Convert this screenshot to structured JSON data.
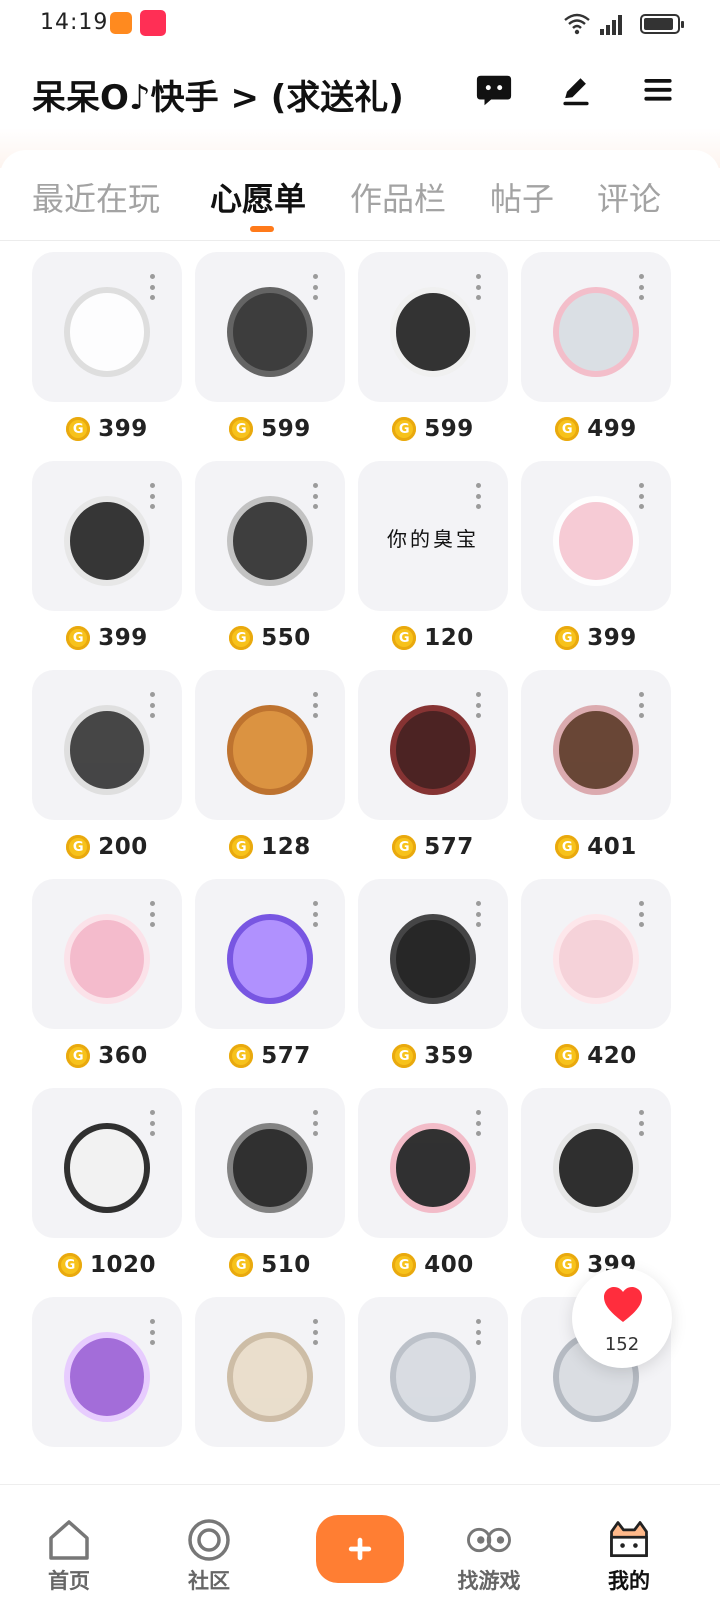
{
  "status_bar": {
    "time": "14:19",
    "network": "5G"
  },
  "header": {
    "title": "呆呆O♪快手 > (求送礼)",
    "icons": [
      "message-icon",
      "edit-icon",
      "menu-icon"
    ]
  },
  "tabs": [
    {
      "label": "最近在玩",
      "active": false
    },
    {
      "label": "心愿单",
      "active": true
    },
    {
      "label": "作品栏",
      "active": false
    },
    {
      "label": "帖子",
      "active": false
    },
    {
      "label": "评论",
      "active": false
    }
  ],
  "currency_icon": "coin-icon",
  "currency_symbol": "G",
  "items": [
    {
      "price": "399",
      "image": "white-feather-wing"
    },
    {
      "price": "599",
      "image": "black-dragon"
    },
    {
      "price": "599",
      "image": "black-white-jacket"
    },
    {
      "price": "499",
      "image": "silver-bob-hair-with-bow"
    },
    {
      "price": "399",
      "image": "striped-platform-boots"
    },
    {
      "price": "550",
      "image": "striped-hoodie"
    },
    {
      "price": "120",
      "image": "text-accessory",
      "text": "你的臭宝"
    },
    {
      "price": "399",
      "image": "pink-striped-boots"
    },
    {
      "price": "200",
      "image": "floating-text-accessory"
    },
    {
      "price": "128",
      "image": "taiyaki-fish"
    },
    {
      "price": "577",
      "image": "pentagram-drone-effect"
    },
    {
      "price": "401",
      "image": "brown-hair-beret"
    },
    {
      "price": "360",
      "image": "pink-floral-dress"
    },
    {
      "price": "577",
      "image": "purple-magic-circle"
    },
    {
      "price": "359",
      "image": "black-long-hair"
    },
    {
      "price": "420",
      "image": "pink-off-shoulder-top"
    },
    {
      "price": "1020",
      "image": "white-long-hair"
    },
    {
      "price": "510",
      "image": "black-crop-sweater"
    },
    {
      "price": "400",
      "image": "ruffle-skirt-striped-socks"
    },
    {
      "price": "399",
      "image": "zebra-boots"
    },
    {
      "price": "",
      "image": "purple-cat-hoodie"
    },
    {
      "price": "",
      "image": "blonde-long-hair"
    },
    {
      "price": "",
      "image": "silver-short-hair"
    },
    {
      "price": "",
      "image": "silver-bun-hair"
    }
  ],
  "like_bubble": {
    "icon": "heart-icon",
    "count": "152",
    "color": "#ff2d3d"
  },
  "bottom_nav": [
    {
      "label": "首页",
      "icon": "home-icon",
      "active": false
    },
    {
      "label": "社区",
      "icon": "community-icon",
      "active": false
    },
    {
      "label": "",
      "icon": "plus-icon",
      "active": false
    },
    {
      "label": "找游戏",
      "icon": "find-games-icon",
      "active": false
    },
    {
      "label": "我的",
      "icon": "profile-cat-icon",
      "active": true
    }
  ],
  "colors": {
    "accent": "#ff7a1a",
    "coin": "#f7c21b",
    "card_bg": "#f3f3f6"
  }
}
